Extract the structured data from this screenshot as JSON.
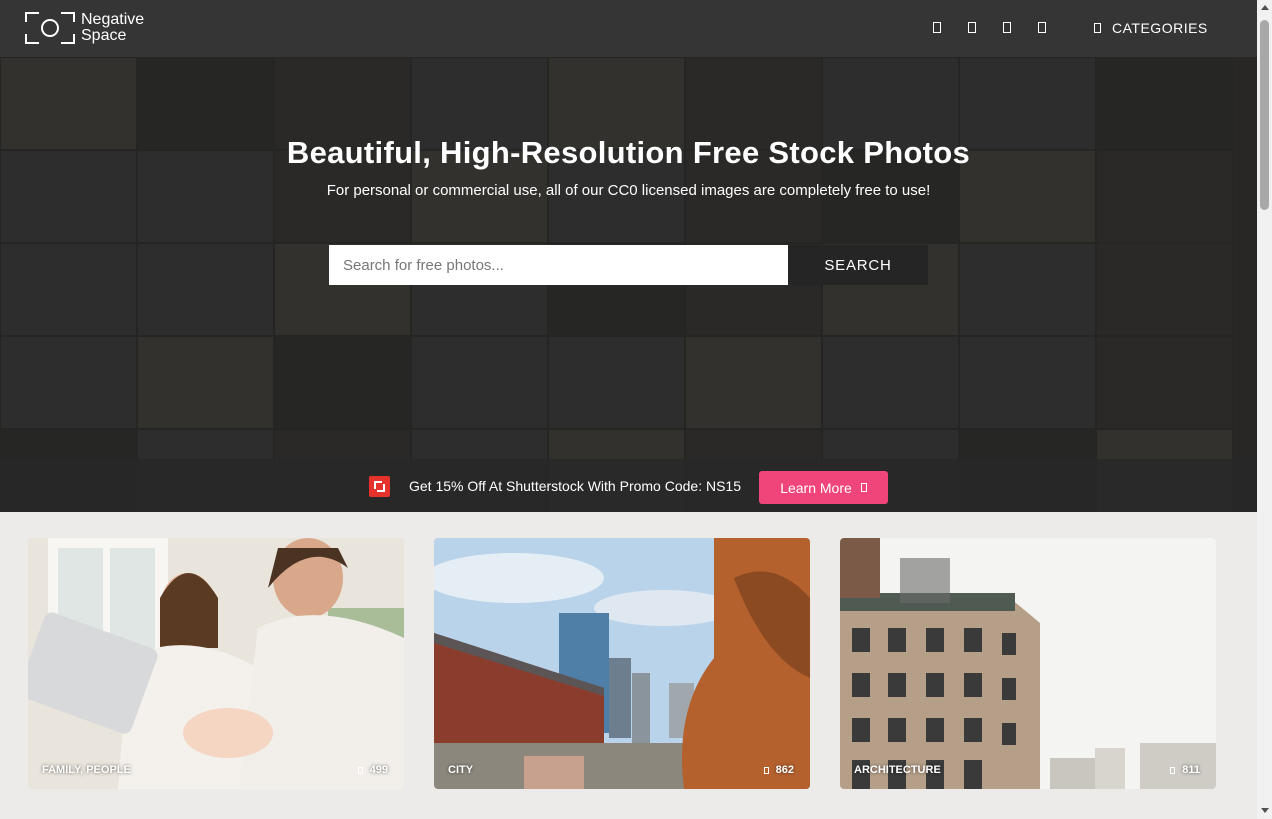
{
  "header": {
    "logo_line1": "Negative",
    "logo_line2": "Space",
    "categories_label": "CATEGORIES",
    "icons": [
      "social-icon-1",
      "social-icon-2",
      "social-icon-3",
      "social-icon-4"
    ]
  },
  "hero": {
    "title": "Beautiful, High-Resolution Free Stock Photos",
    "subtitle": "For personal or commercial use, all of our CC0 licensed images are completely free to use!",
    "search": {
      "placeholder": "Search for free photos...",
      "value": "",
      "button_label": "SEARCH"
    }
  },
  "promo": {
    "text": "Get 15% Off At Shutterstock With Promo Code: NS15",
    "button_label": "Learn More",
    "logo_color": "#e5322d",
    "button_color": "#f0457a"
  },
  "categories": [
    {
      "label": "FAMILY, PEOPLE",
      "count": "499"
    },
    {
      "label": "CITY",
      "count": "862"
    },
    {
      "label": "ARCHITECTURE",
      "count": "811"
    }
  ]
}
